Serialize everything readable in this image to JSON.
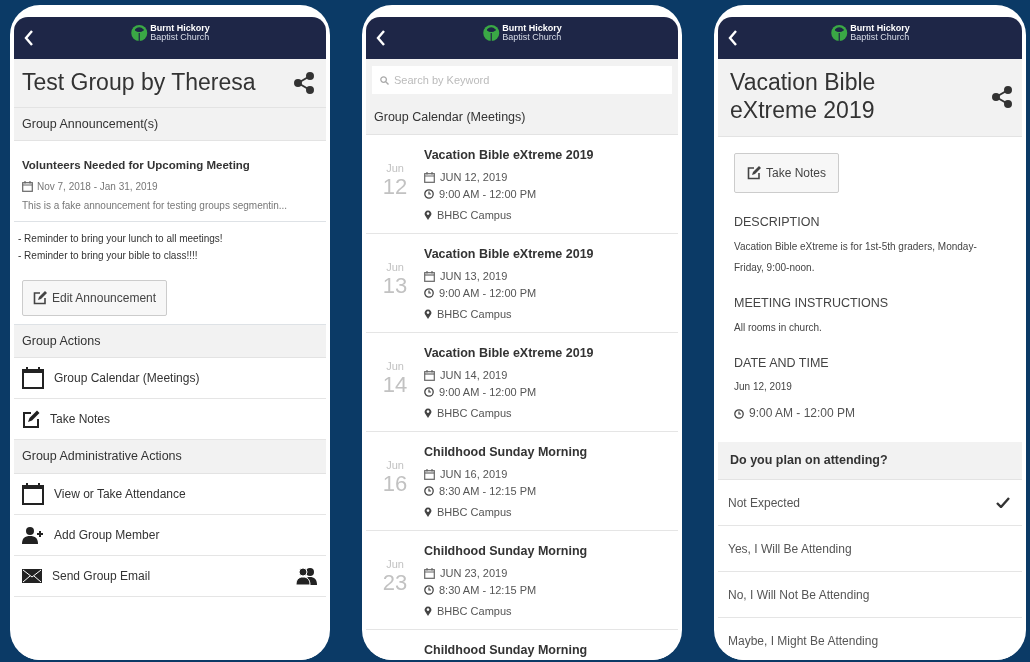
{
  "phones": [
    {
      "kind": "group",
      "logo": {
        "line_1": "Burnt Hickory",
        "line_2": "Baptist Church"
      },
      "title": "Test Group by Theresa",
      "announcements_header": "Group Announcement(s)",
      "announcement": {
        "title": "Volunteers Needed for Upcoming Meeting",
        "dates": "Nov 7, 2018 - Jan 31, 2019",
        "snippet": "This is a fake announcement for testing groups segmentin..."
      },
      "notes": [
        "- Reminder to bring your lunch to all meetings!",
        "- Reminder to bring your bible to class!!!!"
      ],
      "edit_button": "Edit Announcement",
      "sections": [
        {
          "header": "Group Actions",
          "items": [
            {
              "kind": "calendar",
              "label": "Group Calendar (Meetings)",
              "members_icon": false
            },
            {
              "kind": "notes",
              "label": "Take Notes",
              "members_icon": false
            }
          ]
        },
        {
          "header": "Group Administrative Actions",
          "items": [
            {
              "kind": "calendar",
              "label": "View or Take Attendance",
              "members_icon": false
            },
            {
              "kind": "add-member",
              "label": "Add Group Member",
              "members_icon": false
            },
            {
              "kind": "email",
              "label": "Send Group Email",
              "members_icon": true
            }
          ]
        }
      ]
    },
    {
      "kind": "calendar",
      "logo": {
        "line_1": "Burnt Hickory",
        "line_2": "Baptist Church"
      },
      "search": {
        "placeholder": "Search by Keyword"
      },
      "header": "Group Calendar (Meetings)",
      "events": [
        {
          "month": "Jun",
          "day": "12",
          "title": "Vacation Bible eXtreme 2019",
          "date": "JUN 12, 2019",
          "time": "9:00 AM - 12:00 PM",
          "location": "BHBC Campus"
        },
        {
          "month": "Jun",
          "day": "13",
          "title": "Vacation Bible eXtreme 2019",
          "date": "JUN 13, 2019",
          "time": "9:00 AM - 12:00 PM",
          "location": "BHBC Campus"
        },
        {
          "month": "Jun",
          "day": "14",
          "title": "Vacation Bible eXtreme 2019",
          "date": "JUN 14, 2019",
          "time": "9:00 AM - 12:00 PM",
          "location": "BHBC Campus"
        },
        {
          "month": "Jun",
          "day": "16",
          "title": "Childhood Sunday Morning",
          "date": "JUN 16, 2019",
          "time": "8:30 AM - 12:15 PM",
          "location": "BHBC Campus"
        },
        {
          "month": "Jun",
          "day": "23",
          "title": "Childhood Sunday Morning",
          "date": "JUN 23, 2019",
          "time": "8:30 AM - 12:15 PM",
          "location": "BHBC Campus"
        },
        {
          "title": "Childhood Sunday Morning"
        }
      ]
    },
    {
      "kind": "event",
      "logo": {
        "line_1": "Burnt Hickory",
        "line_2": "Baptist Church"
      },
      "title": "Vacation Bible eXtreme 2019",
      "notes_button": "Take Notes",
      "details": [
        {
          "heading": "DESCRIPTION",
          "lines": [
            "Vacation Bible eXtreme is for 1st-5th graders, Monday-Friday, 9:00-noon."
          ]
        },
        {
          "heading": "MEETING INSTRUCTIONS",
          "lines": [
            "All rooms in church."
          ]
        },
        {
          "heading": "DATE AND TIME",
          "lines": [
            "Jun 12, 2019"
          ],
          "time": "9:00 AM - 12:00 PM"
        }
      ],
      "question": "Do you plan on attending?",
      "options": [
        {
          "label": "Not Expected",
          "selected": true
        },
        {
          "label": "Yes, I Will Be Attending",
          "selected": false
        },
        {
          "label": "No, I Will Not Be Attending",
          "selected": false
        },
        {
          "label": "Maybe, I Might Be Attending",
          "selected": false
        }
      ]
    }
  ]
}
